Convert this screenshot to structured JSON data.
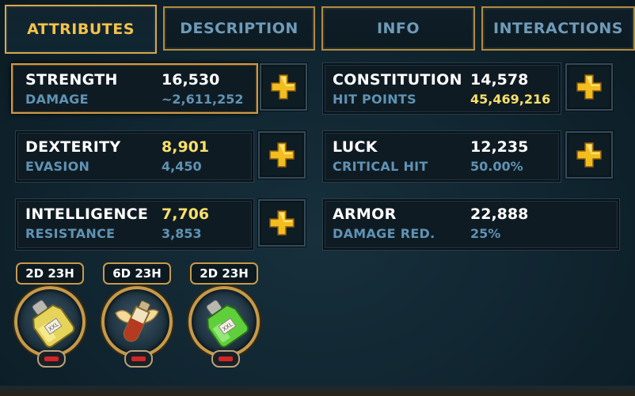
{
  "tabs": [
    {
      "label": "ATTRIBUTES",
      "active": true
    },
    {
      "label": "DESCRIPTION",
      "active": false
    },
    {
      "label": "INFO",
      "active": false
    },
    {
      "label": "INTERACTIONS",
      "active": false
    }
  ],
  "stats": {
    "strength": {
      "name": "STRENGTH",
      "sub": "DAMAGE",
      "value": "16,530",
      "subvalue": "~2,611,252"
    },
    "constitution": {
      "name": "CONSTITUTION",
      "sub": "HIT POINTS",
      "value": "14,578",
      "subvalue": "45,469,216"
    },
    "dexterity": {
      "name": "DEXTERITY",
      "sub": "EVASION",
      "value": "8,901",
      "subvalue": "4,450"
    },
    "luck": {
      "name": "LUCK",
      "sub": "CRITICAL HIT",
      "value": "12,235",
      "subvalue": "50.00%"
    },
    "intelligence": {
      "name": "INTELLIGENCE",
      "sub": "RESISTANCE",
      "value": "7,706",
      "subvalue": "3,853"
    },
    "armor": {
      "name": "ARMOR",
      "sub": "DAMAGE RED.",
      "value": "22,888",
      "subvalue": "25%"
    }
  },
  "potions": [
    {
      "timer": "2D 23H",
      "icon": "yellow-potion-icon",
      "label": "XXL"
    },
    {
      "timer": "6D 23H",
      "icon": "winged-potion-icon",
      "label": ""
    },
    {
      "timer": "2D 23H",
      "icon": "green-potion-icon",
      "label": "XXL"
    }
  ],
  "colors": {
    "gold": "#f4c24a",
    "tab_inactive": "#6f9bb8",
    "stat_highlight": "#f7e06a",
    "sub_text": "#5f93b4",
    "plus_icon": "#f2bd1f",
    "minus_icon": "#d42626"
  }
}
